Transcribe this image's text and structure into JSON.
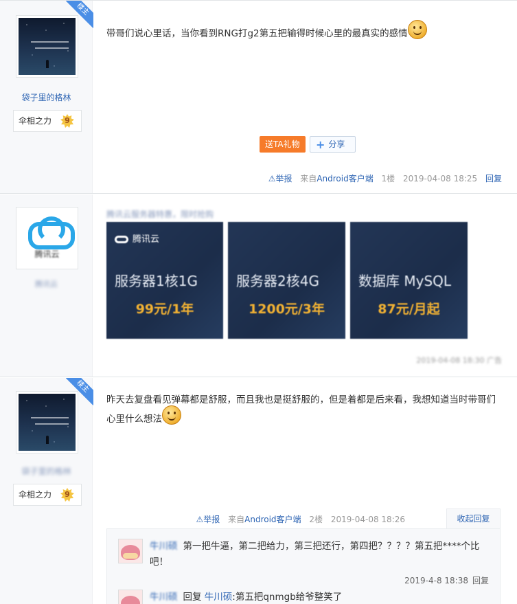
{
  "posts": [
    {
      "op_badge": "楼主",
      "username": "袋子里的格林",
      "rank_title": "伞相之力",
      "rank_level": "9",
      "content": "带哥们说心里话，当你看到RNG打g2第五把输得时候心里的最真实的感情",
      "buttons": {
        "gift": "送TA礼物",
        "share": "分享"
      },
      "tail": {
        "report": "举报",
        "source_prefix": "来自",
        "source": "Android客户端",
        "floor": "1楼",
        "time": "2019-04-08 18:25",
        "reply": "回复"
      }
    },
    {
      "is_ad": true,
      "brand": "腾讯云",
      "caption": "腾讯云服务器特惠，限时抢购",
      "tiles": [
        {
          "title": "服务器1核1G",
          "price": "99元/1年"
        },
        {
          "title": "服务器2核4G",
          "price": "1200元/3年"
        },
        {
          "title": "数据库 MySQL",
          "price": "87元/月起"
        }
      ],
      "time": "2019-04-08 18:30 广告"
    },
    {
      "op_badge": "楼主",
      "username": "袋子里的格林",
      "rank_title": "伞相之力",
      "rank_level": "9",
      "content": "昨天去复盘看见弹幕都是舒服，而且我也是挺舒服的，但是着都是后来看，我想知道当时带哥们心里什么想法",
      "tail": {
        "report": "举报",
        "source_prefix": "来自",
        "source": "Android客户端",
        "floor": "2楼",
        "time": "2019-04-08 18:26",
        "collapse": "收起回复"
      },
      "replies": [
        {
          "name": "牛川硕",
          "text": "第一把牛逼，第二把给力，第三把还行，第四把？？？？第五把****个比吧！",
          "time": "2019-4-8 18:38",
          "reply": "回复"
        },
        {
          "name": "牛川硕",
          "reply_word": "回复",
          "reply_to": "牛川硕",
          "text": ":第五把qnmgb给爷整笑了"
        }
      ]
    }
  ]
}
